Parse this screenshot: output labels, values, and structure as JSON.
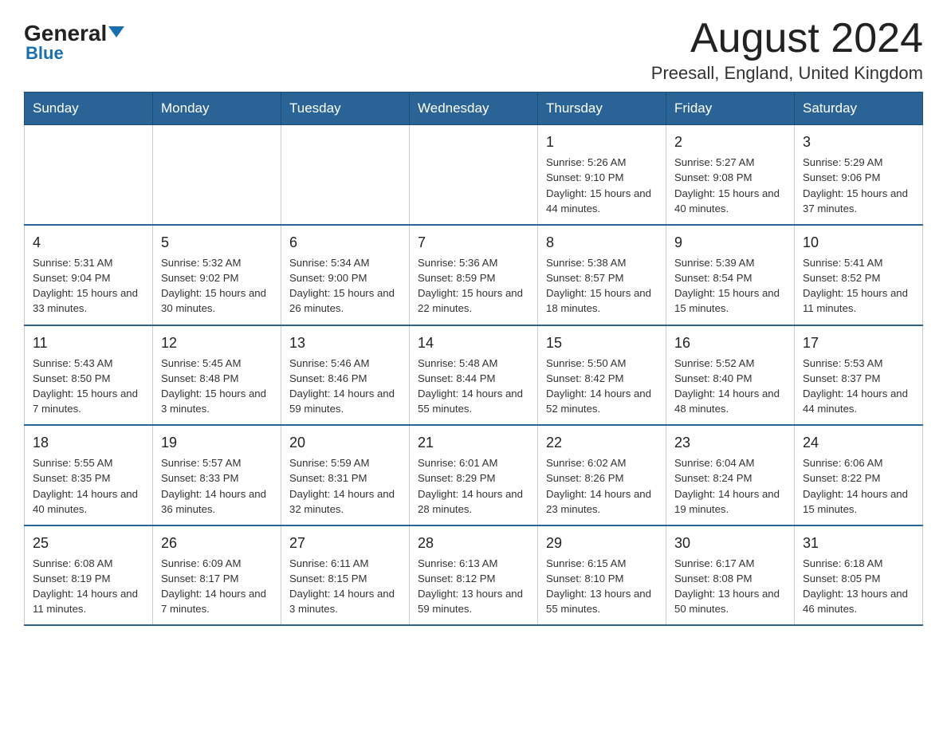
{
  "logo": {
    "text_general": "General",
    "triangle": "▶",
    "text_blue": "Blue"
  },
  "header": {
    "title": "August 2024",
    "subtitle": "Preesall, England, United Kingdom"
  },
  "weekdays": [
    "Sunday",
    "Monday",
    "Tuesday",
    "Wednesday",
    "Thursday",
    "Friday",
    "Saturday"
  ],
  "weeks": [
    [
      {
        "day": "",
        "info": ""
      },
      {
        "day": "",
        "info": ""
      },
      {
        "day": "",
        "info": ""
      },
      {
        "day": "",
        "info": ""
      },
      {
        "day": "1",
        "info": "Sunrise: 5:26 AM\nSunset: 9:10 PM\nDaylight: 15 hours and 44 minutes."
      },
      {
        "day": "2",
        "info": "Sunrise: 5:27 AM\nSunset: 9:08 PM\nDaylight: 15 hours and 40 minutes."
      },
      {
        "day": "3",
        "info": "Sunrise: 5:29 AM\nSunset: 9:06 PM\nDaylight: 15 hours and 37 minutes."
      }
    ],
    [
      {
        "day": "4",
        "info": "Sunrise: 5:31 AM\nSunset: 9:04 PM\nDaylight: 15 hours and 33 minutes."
      },
      {
        "day": "5",
        "info": "Sunrise: 5:32 AM\nSunset: 9:02 PM\nDaylight: 15 hours and 30 minutes."
      },
      {
        "day": "6",
        "info": "Sunrise: 5:34 AM\nSunset: 9:00 PM\nDaylight: 15 hours and 26 minutes."
      },
      {
        "day": "7",
        "info": "Sunrise: 5:36 AM\nSunset: 8:59 PM\nDaylight: 15 hours and 22 minutes."
      },
      {
        "day": "8",
        "info": "Sunrise: 5:38 AM\nSunset: 8:57 PM\nDaylight: 15 hours and 18 minutes."
      },
      {
        "day": "9",
        "info": "Sunrise: 5:39 AM\nSunset: 8:54 PM\nDaylight: 15 hours and 15 minutes."
      },
      {
        "day": "10",
        "info": "Sunrise: 5:41 AM\nSunset: 8:52 PM\nDaylight: 15 hours and 11 minutes."
      }
    ],
    [
      {
        "day": "11",
        "info": "Sunrise: 5:43 AM\nSunset: 8:50 PM\nDaylight: 15 hours and 7 minutes."
      },
      {
        "day": "12",
        "info": "Sunrise: 5:45 AM\nSunset: 8:48 PM\nDaylight: 15 hours and 3 minutes."
      },
      {
        "day": "13",
        "info": "Sunrise: 5:46 AM\nSunset: 8:46 PM\nDaylight: 14 hours and 59 minutes."
      },
      {
        "day": "14",
        "info": "Sunrise: 5:48 AM\nSunset: 8:44 PM\nDaylight: 14 hours and 55 minutes."
      },
      {
        "day": "15",
        "info": "Sunrise: 5:50 AM\nSunset: 8:42 PM\nDaylight: 14 hours and 52 minutes."
      },
      {
        "day": "16",
        "info": "Sunrise: 5:52 AM\nSunset: 8:40 PM\nDaylight: 14 hours and 48 minutes."
      },
      {
        "day": "17",
        "info": "Sunrise: 5:53 AM\nSunset: 8:37 PM\nDaylight: 14 hours and 44 minutes."
      }
    ],
    [
      {
        "day": "18",
        "info": "Sunrise: 5:55 AM\nSunset: 8:35 PM\nDaylight: 14 hours and 40 minutes."
      },
      {
        "day": "19",
        "info": "Sunrise: 5:57 AM\nSunset: 8:33 PM\nDaylight: 14 hours and 36 minutes."
      },
      {
        "day": "20",
        "info": "Sunrise: 5:59 AM\nSunset: 8:31 PM\nDaylight: 14 hours and 32 minutes."
      },
      {
        "day": "21",
        "info": "Sunrise: 6:01 AM\nSunset: 8:29 PM\nDaylight: 14 hours and 28 minutes."
      },
      {
        "day": "22",
        "info": "Sunrise: 6:02 AM\nSunset: 8:26 PM\nDaylight: 14 hours and 23 minutes."
      },
      {
        "day": "23",
        "info": "Sunrise: 6:04 AM\nSunset: 8:24 PM\nDaylight: 14 hours and 19 minutes."
      },
      {
        "day": "24",
        "info": "Sunrise: 6:06 AM\nSunset: 8:22 PM\nDaylight: 14 hours and 15 minutes."
      }
    ],
    [
      {
        "day": "25",
        "info": "Sunrise: 6:08 AM\nSunset: 8:19 PM\nDaylight: 14 hours and 11 minutes."
      },
      {
        "day": "26",
        "info": "Sunrise: 6:09 AM\nSunset: 8:17 PM\nDaylight: 14 hours and 7 minutes."
      },
      {
        "day": "27",
        "info": "Sunrise: 6:11 AM\nSunset: 8:15 PM\nDaylight: 14 hours and 3 minutes."
      },
      {
        "day": "28",
        "info": "Sunrise: 6:13 AM\nSunset: 8:12 PM\nDaylight: 13 hours and 59 minutes."
      },
      {
        "day": "29",
        "info": "Sunrise: 6:15 AM\nSunset: 8:10 PM\nDaylight: 13 hours and 55 minutes."
      },
      {
        "day": "30",
        "info": "Sunrise: 6:17 AM\nSunset: 8:08 PM\nDaylight: 13 hours and 50 minutes."
      },
      {
        "day": "31",
        "info": "Sunrise: 6:18 AM\nSunset: 8:05 PM\nDaylight: 13 hours and 46 minutes."
      }
    ]
  ]
}
